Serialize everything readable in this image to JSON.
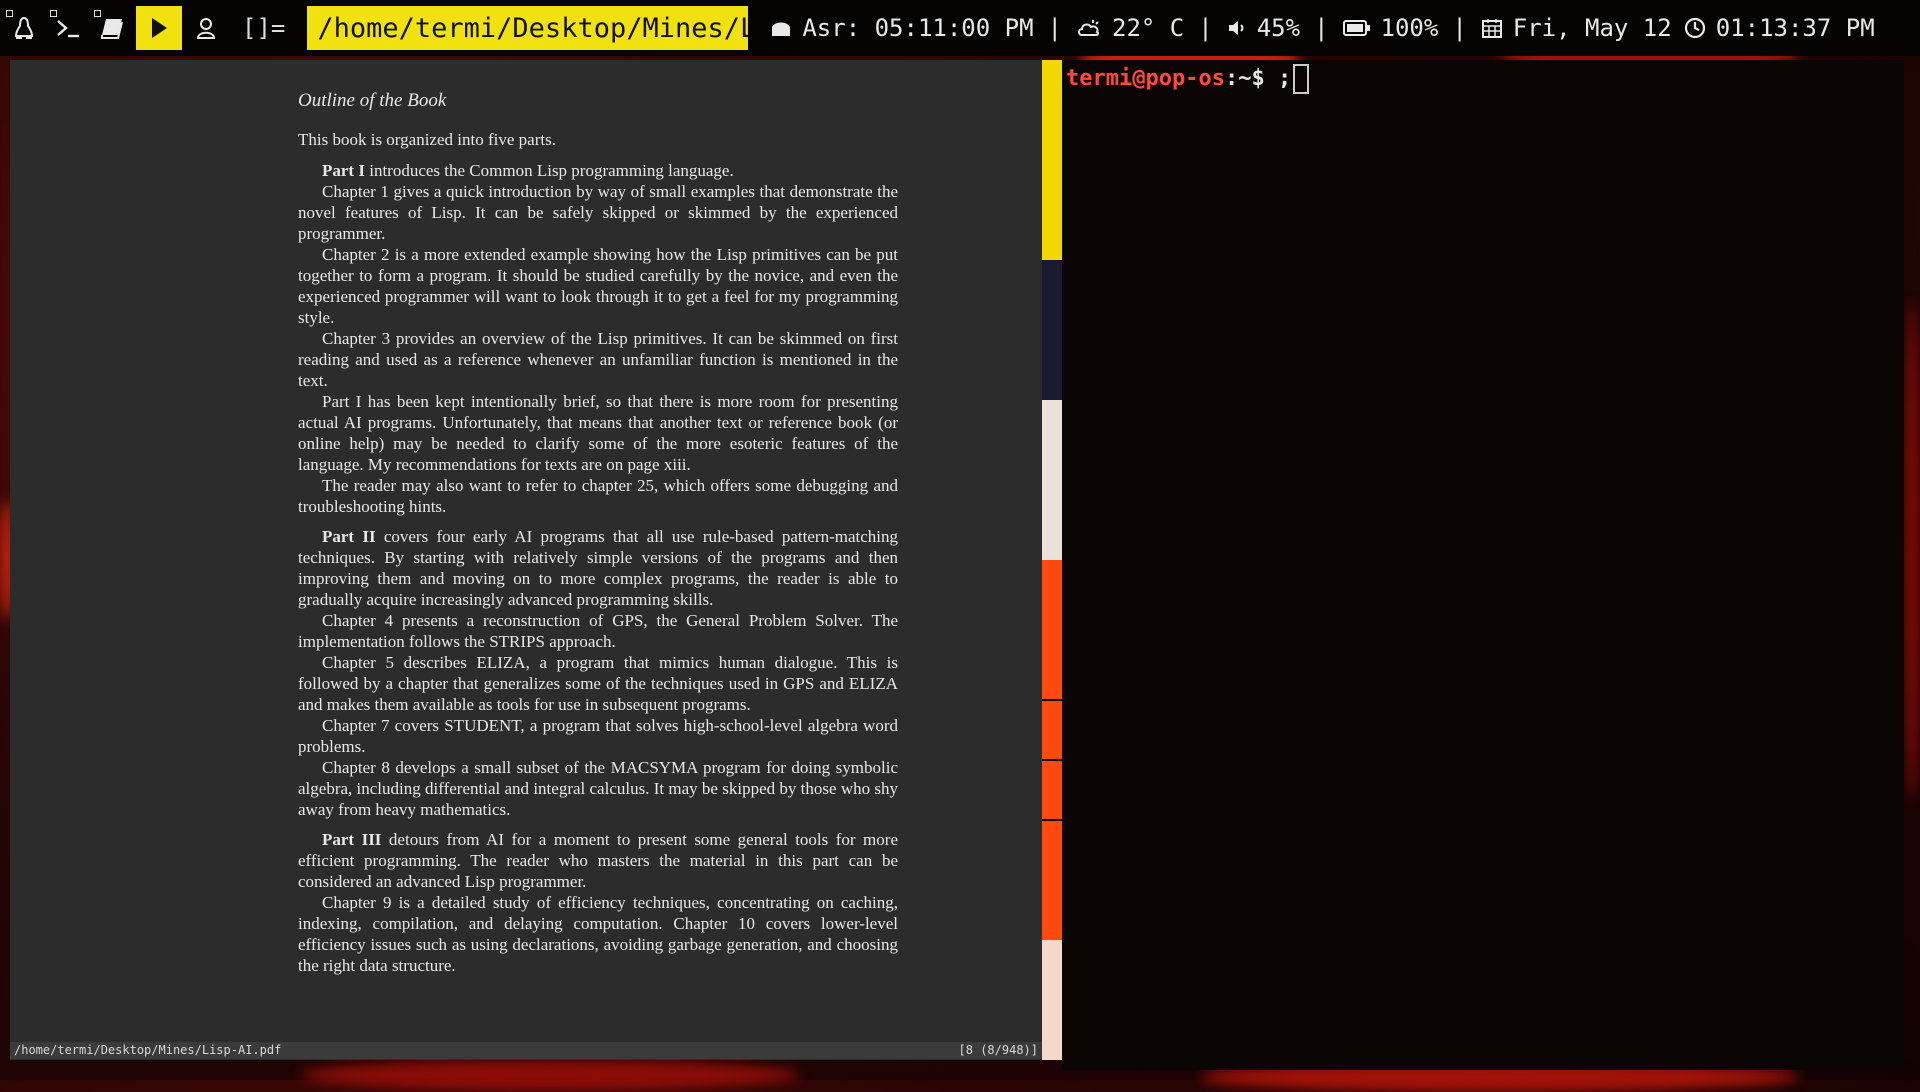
{
  "topbar": {
    "workspaces": [
      {
        "icon": "linux-penguin-icon"
      },
      {
        "icon": "terminal-prompt-icon"
      },
      {
        "icon": "book-icon"
      },
      {
        "icon": "play-icon",
        "active": true
      },
      {
        "icon": "user-icon"
      }
    ],
    "layout_symbol": "[]=",
    "window_title": "/home/termi/Desktop/Mines/L...",
    "prayer": "Asr: 05:11:00 PM",
    "weather": "22° C",
    "volume": "45%",
    "battery": "100%",
    "date": "Fri, May 12",
    "time": "01:13:37 PM",
    "separator": "|",
    "colors": {
      "accent": "#f0e10f",
      "bar_bg": "#050202"
    }
  },
  "document": {
    "heading": "Outline of the Book",
    "paragraphs": [
      {
        "class": "noindent",
        "lead": "",
        "text": "This book is organized into five parts."
      },
      {
        "class": "",
        "lead": "Part I",
        "text": " introduces the Common Lisp programming language."
      },
      {
        "class": "",
        "lead": "",
        "text": "Chapter 1 gives a quick introduction by way of small examples that demonstrate the novel features of Lisp. It can be safely skipped or skimmed by the experienced programmer."
      },
      {
        "class": "",
        "lead": "",
        "text": "Chapter 2 is a more extended example showing how the Lisp primitives can be put together to form a program. It should be studied carefully by the novice, and even the experienced programmer will want to look through it to get a feel for my programming style."
      },
      {
        "class": "",
        "lead": "",
        "text": "Chapter 3 provides an overview of the Lisp primitives. It can be skimmed on first reading and used as a reference whenever an unfamiliar function is mentioned in the text."
      },
      {
        "class": "",
        "lead": "",
        "text": "Part I has been kept intentionally brief, so that there is more room for presenting actual AI programs. Unfortunately, that means that another text or reference book (or online help) may be needed to clarify some of the more esoteric features of the language. My recommendations for texts are on page xiii."
      },
      {
        "class": "",
        "lead": "",
        "text": "The reader may also want to refer to chapter 25, which offers some debugging and troubleshooting hints."
      },
      {
        "class": "gap",
        "lead": "Part II",
        "text": " covers four early AI programs that all use rule-based pattern-matching techniques. By starting with relatively simple versions of the programs and then improving them and moving on to more complex programs, the reader is able to gradually acquire increasingly advanced programming skills."
      },
      {
        "class": "",
        "lead": "",
        "text": "Chapter 4 presents a reconstruction of GPS, the General Problem Solver. The implementation follows the STRIPS approach."
      },
      {
        "class": "",
        "lead": "",
        "text": "Chapter 5 describes ELIZA, a program that mimics human dialogue. This is followed by a chapter that generalizes some of the techniques used in GPS and ELIZA and makes them available as tools for use in subsequent programs."
      },
      {
        "class": "",
        "lead": "",
        "text": "Chapter 7 covers STUDENT, a program that solves high-school-level algebra word problems."
      },
      {
        "class": "",
        "lead": "",
        "text": "Chapter 8 develops a small subset of the MACSYMA program for doing symbolic algebra, including differential and integral calculus. It may be skipped by those who shy away from heavy mathematics."
      },
      {
        "class": "gap",
        "lead": "Part III",
        "text": " detours from AI for a moment to present some general tools for more efficient programming. The reader who masters the material in this part can be considered an advanced Lisp programmer."
      },
      {
        "class": "",
        "lead": "",
        "text": "Chapter 9 is a detailed study of efficiency techniques, concentrating on caching, indexing, compilation, and delaying computation. Chapter 10 covers lower-level efficiency issues such as using declarations, avoiding garbage generation, and choosing the right data structure."
      }
    ]
  },
  "viewer_status": {
    "path": "/home/termi/Desktop/Mines/Lisp-AI.pdf",
    "page_indicator": "[8 (8/948)]"
  },
  "terminal": {
    "user_host": "termi@pop-os",
    "cwd": ":~",
    "prompt_symbol": "$",
    "input": ";"
  }
}
